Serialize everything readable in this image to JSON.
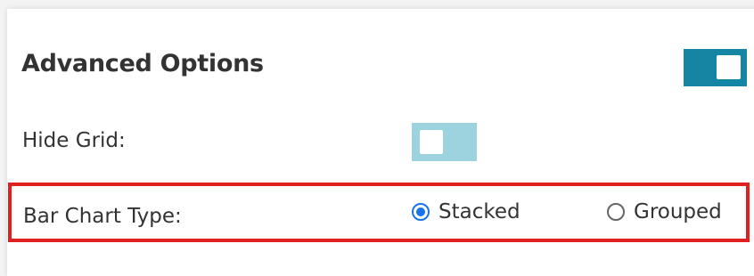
{
  "advanced_options": {
    "title": "Advanced Options",
    "toggle_state": "on",
    "toggle_color": "#1486a3"
  },
  "hide_grid": {
    "label": "Hide Grid:",
    "toggle_state": "off",
    "toggle_color": "#9dd3df"
  },
  "bar_chart_type": {
    "label": "Bar Chart Type:",
    "options": [
      {
        "label": "Stacked",
        "selected": true
      },
      {
        "label": "Grouped",
        "selected": false
      }
    ],
    "highlight_color": "#e0201f",
    "radio_accent": "#1a73e8"
  }
}
